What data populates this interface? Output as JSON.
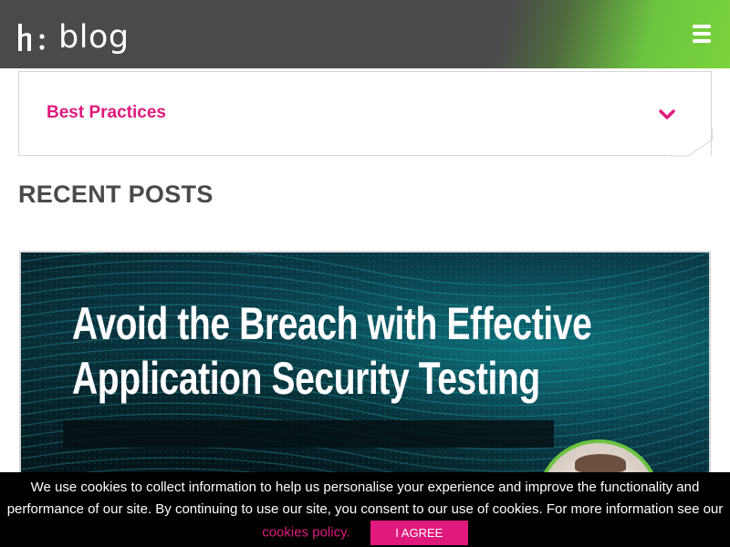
{
  "header": {
    "logo_text": "blog",
    "logo_icon": "hackerone-h1-logo",
    "menu_icon": "hamburger-menu-icon"
  },
  "category": {
    "label": "Best Practices",
    "chevron_icon": "chevron-down-icon"
  },
  "recent_posts": {
    "title": "RECENT POSTS",
    "posts": [
      {
        "title_line1": "Avoid the Breach with Effective",
        "title_line2": "Application Security Testing"
      }
    ]
  },
  "cookie_banner": {
    "text": "We use cookies to collect information to help us personalise your experience and improve the functionality and performance of our site. By continuing to use our site, you consent to our use of cookies. For more information see our",
    "link_text": "cookies policy.",
    "agree_label": "I AGREE"
  },
  "colors": {
    "header_bg": "#4a494c",
    "accent_green": "#6cc440",
    "accent_pink": "#e0197d",
    "heading_gray": "#4a494c"
  }
}
